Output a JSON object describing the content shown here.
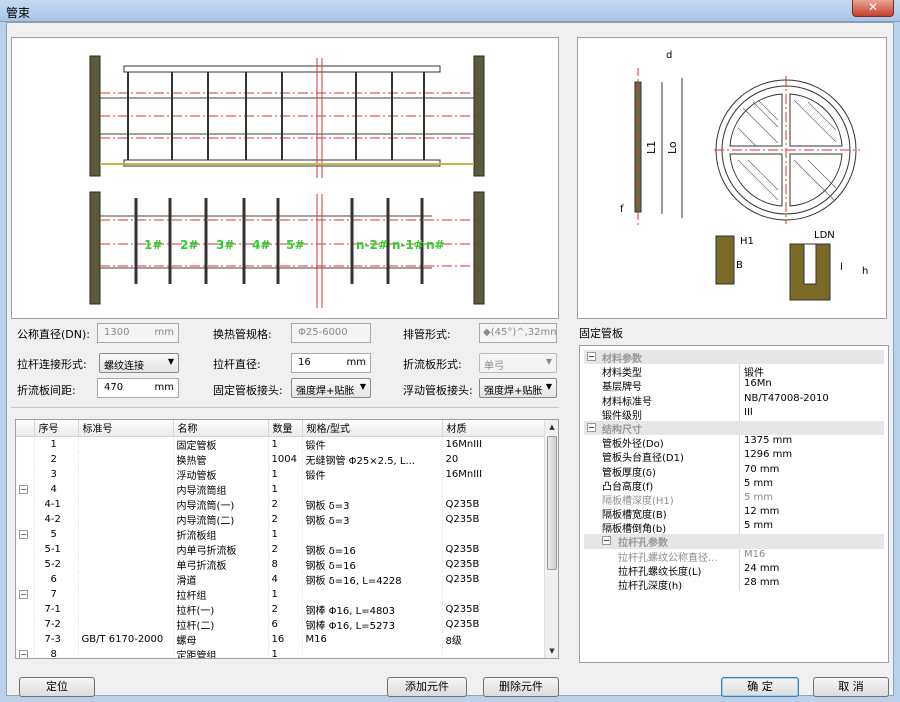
{
  "window": {
    "title": "管束",
    "close_glyph": "✕"
  },
  "form": {
    "nominal_diameter": {
      "label": "公称直径(DN):",
      "value": "1300",
      "unit": "mm"
    },
    "tube_spec": {
      "label": "换热管规格:",
      "value": "Φ25-6000"
    },
    "layout": {
      "label": "排管形式:",
      "value": "◆(45°)^,32mm"
    },
    "tie_rod_connection": {
      "label": "拉杆连接形式:",
      "value": "螺纹连接"
    },
    "tie_rod_diameter": {
      "label": "拉杆直径:",
      "value": "16",
      "unit": "mm"
    },
    "baffle_type": {
      "label": "折流板形式:",
      "value": "单弓"
    },
    "baffle_spacing": {
      "label": "折流板间距:",
      "value": "470",
      "unit": "mm"
    },
    "fixed_tubesheet_joint": {
      "label": "固定管板接头:",
      "value": "强度焊+贴胀"
    },
    "floating_tubesheet_joint": {
      "label": "浮动管板接头:",
      "value": "强度焊+贴胀"
    }
  },
  "drawing": {
    "labels": [
      "1#",
      "2#",
      "3#",
      "4#",
      "5#",
      "n-2#",
      "n-1#",
      "n#"
    ],
    "dim_labels": {
      "d": "d",
      "l1": "L1",
      "lo": "Lo",
      "f": "f",
      "h1": "H1",
      "b": "B",
      "ldn": "LDN",
      "l": "l",
      "h": "h"
    }
  },
  "table": {
    "columns": [
      "序号",
      "标准号",
      "名称",
      "数量",
      "规格/型式",
      "材质"
    ],
    "rows": [
      {
        "tree": "",
        "seq": "1",
        "std": "",
        "name": "固定管板",
        "qty": "1",
        "spec": "锻件",
        "mat": "16MnIII"
      },
      {
        "tree": "",
        "seq": "2",
        "std": "",
        "name": "换热管",
        "qty": "1004",
        "spec": "无缝钢管 Φ25×2.5, L...",
        "mat": "20"
      },
      {
        "tree": "",
        "seq": "3",
        "std": "",
        "name": "浮动管板",
        "qty": "1",
        "spec": "锻件",
        "mat": "16MnIII"
      },
      {
        "tree": "−",
        "seq": "4",
        "std": "",
        "name": "内导流筒组",
        "qty": "1",
        "spec": "",
        "mat": ""
      },
      {
        "tree": "",
        "seq": "4-1",
        "std": "",
        "name": "内导流筒(一)",
        "qty": "2",
        "spec": "钢板 δ=3",
        "mat": "Q235B"
      },
      {
        "tree": "",
        "seq": "4-2",
        "std": "",
        "name": "内导流筒(二)",
        "qty": "2",
        "spec": "钢板 δ=3",
        "mat": "Q235B"
      },
      {
        "tree": "−",
        "seq": "5",
        "std": "",
        "name": "折流板组",
        "qty": "1",
        "spec": "",
        "mat": ""
      },
      {
        "tree": "",
        "seq": "5-1",
        "std": "",
        "name": "内单弓折流板",
        "qty": "2",
        "spec": "钢板 δ=16",
        "mat": "Q235B"
      },
      {
        "tree": "",
        "seq": "5-2",
        "std": "",
        "name": "单弓折流板",
        "qty": "8",
        "spec": "钢板 δ=16",
        "mat": "Q235B"
      },
      {
        "tree": "",
        "seq": "6",
        "std": "",
        "name": "滑道",
        "qty": "4",
        "spec": "钢板 δ=16, L=4228",
        "mat": "Q235B"
      },
      {
        "tree": "−",
        "seq": "7",
        "std": "",
        "name": "拉杆组",
        "qty": "1",
        "spec": "",
        "mat": ""
      },
      {
        "tree": "",
        "seq": "7-1",
        "std": "",
        "name": "拉杆(一)",
        "qty": "2",
        "spec": "钢棒 Φ16, L=4803",
        "mat": "Q235B"
      },
      {
        "tree": "",
        "seq": "7-2",
        "std": "",
        "name": "拉杆(二)",
        "qty": "6",
        "spec": "钢棒 Φ16, L=5273",
        "mat": "Q235B"
      },
      {
        "tree": "",
        "seq": "7-3",
        "std": "GB/T 6170-2000",
        "name": "螺母",
        "qty": "16",
        "spec": "M16",
        "mat": "8级"
      },
      {
        "tree": "−",
        "seq": "8",
        "std": "",
        "name": "定距管组",
        "qty": "1",
        "spec": "",
        "mat": ""
      }
    ]
  },
  "right": {
    "caption": "固定管板",
    "sections": [
      {
        "title": "材料参数",
        "rows": [
          {
            "k": "材料类型",
            "v": "锻件"
          },
          {
            "k": "基层牌号",
            "v": "16Mn"
          },
          {
            "k": "材料标准号",
            "v": "NB/T47008-2010"
          },
          {
            "k": "锻件级别",
            "v": "III"
          }
        ]
      },
      {
        "title": "结构尺寸",
        "rows": [
          {
            "k": "管板外径(Do)",
            "v": "1375  mm"
          },
          {
            "k": "管板头台直径(D1)",
            "v": "1296  mm"
          },
          {
            "k": "管板厚度(δ)",
            "v": "70  mm"
          },
          {
            "k": "凸台高度(f)",
            "v": "5  mm"
          },
          {
            "k": "隔板槽深度(H1)",
            "v": "5  mm",
            "grey": true
          },
          {
            "k": "隔板槽宽度(B)",
            "v": "12  mm"
          },
          {
            "k": "隔板槽倒角(b)",
            "v": "5  mm"
          }
        ]
      },
      {
        "title": "拉杆孔参数",
        "sub": true,
        "rows": [
          {
            "k": "拉杆孔螺纹公称直径...",
            "v": "M16",
            "grey": true
          },
          {
            "k": "拉杆孔螺纹长度(L)",
            "v": "24  mm"
          },
          {
            "k": "拉杆孔深度(h)",
            "v": "28  mm"
          }
        ]
      }
    ]
  },
  "buttons": {
    "locate": "定位",
    "add": "添加元件",
    "delete": "删除元件",
    "ok": "确 定",
    "cancel": "取 消"
  }
}
